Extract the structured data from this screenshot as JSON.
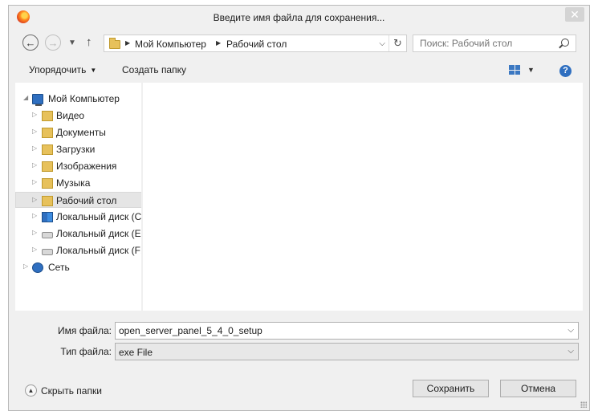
{
  "window": {
    "title": "Введите имя файла для сохранения...",
    "close_glyph": "✕"
  },
  "address_bar": {
    "back_glyph": "←",
    "forward_glyph": "→",
    "up_glyph": "↑",
    "breadcrumbs": [
      "Мой Компьютер",
      "Рабочий стол"
    ],
    "search_placeholder": "Поиск: Рабочий стол"
  },
  "toolbar": {
    "organize_label": "Упорядочить",
    "new_folder_label": "Создать папку",
    "help_glyph": "?"
  },
  "tree": {
    "items": [
      {
        "label": "Мой Компьютер",
        "icon": "computer-icon"
      },
      {
        "label": "Видео",
        "icon": "videos-folder-icon"
      },
      {
        "label": "Документы",
        "icon": "documents-folder-icon"
      },
      {
        "label": "Загрузки",
        "icon": "downloads-folder-icon"
      },
      {
        "label": "Изображения",
        "icon": "pictures-folder-icon"
      },
      {
        "label": "Музыка",
        "icon": "music-folder-icon"
      },
      {
        "label": "Рабочий стол",
        "icon": "desktop-folder-icon",
        "selected": true
      },
      {
        "label": "Локальный диск (C",
        "icon": "system-drive-icon"
      },
      {
        "label": "Локальный диск (E:",
        "icon": "drive-icon"
      },
      {
        "label": "Локальный диск (F:",
        "icon": "drive-icon"
      },
      {
        "label": "Сеть",
        "icon": "network-icon"
      }
    ]
  },
  "form": {
    "filename_label": "Имя файла:",
    "filename_value": "open_server_panel_5_4_0_setup",
    "filetype_label": "Тип файла:",
    "filetype_value": "exe File"
  },
  "footer": {
    "hide_folders_label": "Скрыть папки",
    "save_label": "Сохранить",
    "cancel_label": "Отмена"
  },
  "colors": {
    "accent": "#2f6fc0",
    "folder": "#e7c15b",
    "selected_row": "#e5e5e5",
    "dialog_bg": "#f0f0f0"
  }
}
